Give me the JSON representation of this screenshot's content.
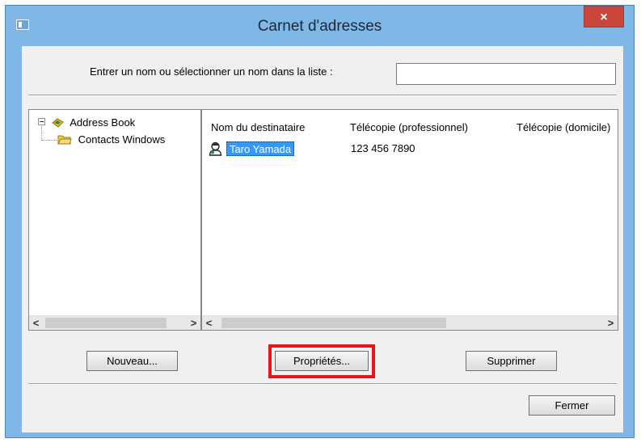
{
  "window": {
    "title": "Carnet d'adresses",
    "close_label": "×"
  },
  "search": {
    "prompt": "Entrer un nom ou sélectionner un nom dans la liste :",
    "value": "",
    "placeholder": ""
  },
  "tree": {
    "root": {
      "label": "Address Book",
      "expanded": true
    },
    "children": [
      {
        "label": "Contacts Windows"
      }
    ]
  },
  "list": {
    "columns": [
      "Nom du destinataire",
      "Télécopie (professionnel)",
      "Télécopie (domicile)"
    ],
    "rows": [
      {
        "name": "Taro Yamada",
        "fax_business": "123 456 7890",
        "selected": true
      }
    ]
  },
  "scroll": {
    "left": "<",
    "right": ">"
  },
  "buttons": {
    "new": "Nouveau...",
    "properties": "Propriétés...",
    "delete": "Supprimer",
    "close": "Fermer"
  },
  "colors": {
    "title_bar": "#7fb7e6",
    "close_button": "#c9463d",
    "selection": "#3399ff",
    "highlight_frame": "#e8141a",
    "dialog_bg": "#f0f0f0"
  }
}
